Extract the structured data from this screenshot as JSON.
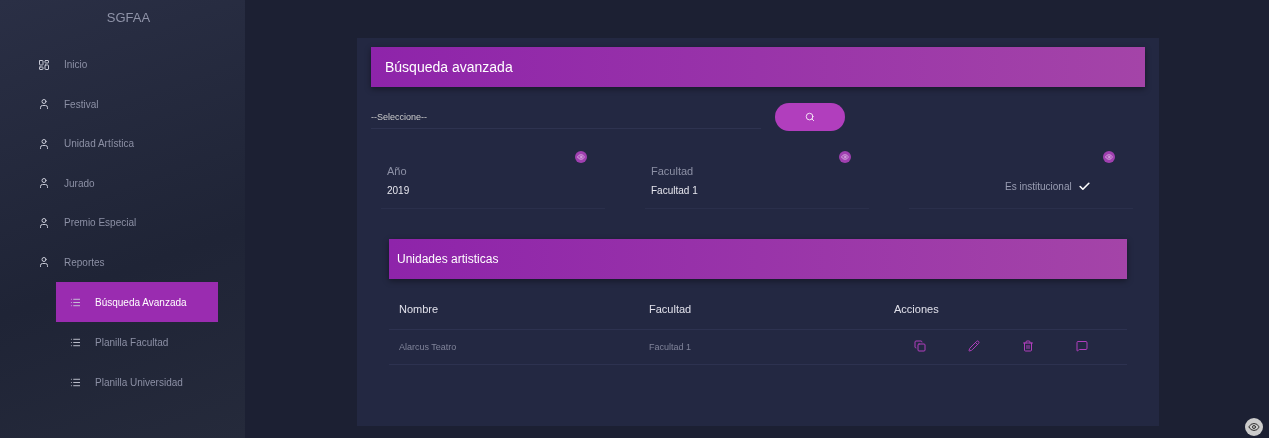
{
  "sidebar": {
    "title": "SGFAA",
    "items": [
      {
        "label": "Inicio",
        "kind": "dashboard",
        "selected": false
      },
      {
        "label": "Festival",
        "kind": "person",
        "selected": false
      },
      {
        "label": "Unidad Artística",
        "kind": "person",
        "selected": false
      },
      {
        "label": "Jurado",
        "kind": "person",
        "selected": false
      },
      {
        "label": "Premio Especial",
        "kind": "person",
        "selected": false
      },
      {
        "label": "Reportes",
        "kind": "person",
        "selected": false,
        "children": [
          {
            "label": "Búsqueda Avanzada",
            "selected": true
          },
          {
            "label": "Planilla Facultad",
            "selected": false
          },
          {
            "label": "Planilla Universidad",
            "selected": false
          }
        ]
      }
    ]
  },
  "search": {
    "title": "Búsqueda avanzada",
    "select": {
      "value": "--Seleccione--"
    },
    "filters": [
      {
        "kind": "field",
        "label": "Año",
        "value": "2019"
      },
      {
        "kind": "field",
        "label": "Facultad",
        "value": "Facultad 1"
      },
      {
        "kind": "checkbox",
        "label": "Es institucional",
        "checked": true
      }
    ]
  },
  "table": {
    "title": "Unidades artisticas",
    "columns": [
      "Nombre",
      "Facultad",
      "Acciones"
    ],
    "rows": [
      {
        "cells": [
          "Alarcus Teatro",
          "Facultad 1"
        ],
        "actions": [
          {
            "kind": "copy"
          },
          {
            "kind": "edit"
          },
          {
            "kind": "delete"
          },
          {
            "kind": "comment"
          }
        ]
      }
    ]
  }
}
